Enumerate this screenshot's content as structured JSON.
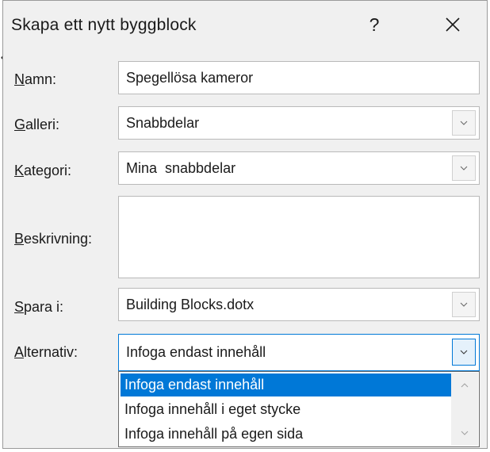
{
  "dialog": {
    "title": "Skapa ett nytt byggblock",
    "help_label": "?"
  },
  "fields": {
    "name": {
      "label_accel": "N",
      "label_rest": "amn:",
      "value": "Spegellösa kameror"
    },
    "gallery": {
      "label_accel": "G",
      "label_rest": "alleri:",
      "value": "Snabbdelar"
    },
    "category": {
      "label_accel": "K",
      "label_rest": "ategori:",
      "value": "Mina  snabbdelar"
    },
    "description": {
      "label_accel": "B",
      "label_rest": "eskrivning:",
      "value": ""
    },
    "save_in": {
      "label_accel": "S",
      "label_rest": "para i:",
      "value": "Building Blocks.dotx"
    },
    "options": {
      "label_accel": "A",
      "label_rest": "lternativ:",
      "value": "Infoga endast innehåll"
    }
  },
  "options_list": [
    "Infoga endast innehåll",
    "Infoga innehåll i eget stycke",
    "Infoga innehåll på egen sida"
  ],
  "colors": {
    "selection": "#0078d7",
    "dialog_bg": "#f0f0f0"
  },
  "icons": [
    "close-icon",
    "chevron-down-icon",
    "chevron-up-icon"
  ]
}
